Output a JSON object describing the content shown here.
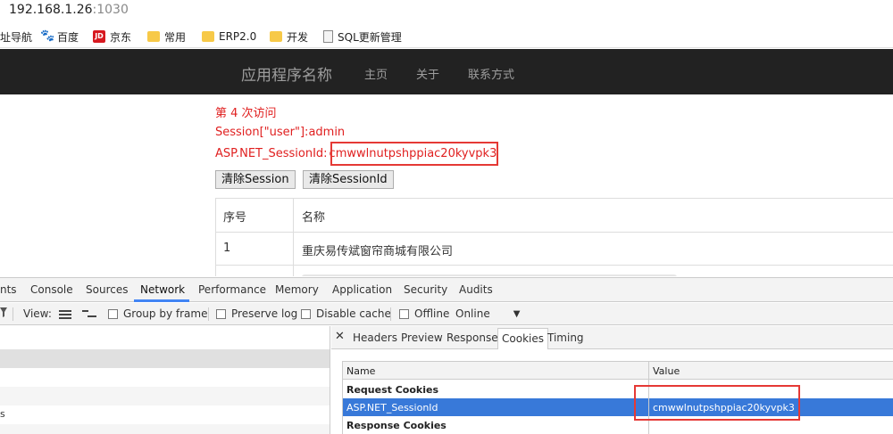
{
  "address_bar": {
    "host": "192.168.1.26",
    "port": ":1030"
  },
  "bookmarks": [
    {
      "label": "址导航",
      "icon": "none"
    },
    {
      "label": "百度",
      "icon": "paw-icon"
    },
    {
      "label": "京东",
      "icon": "jd-icon",
      "icon_text": "JD"
    },
    {
      "label": "常用",
      "icon": "folder-icon"
    },
    {
      "label": "ERP2.0",
      "icon": "folder-icon"
    },
    {
      "label": "开发",
      "icon": "folder-icon"
    },
    {
      "label": "SQL更新管理",
      "icon": "doc-icon"
    }
  ],
  "navbar": {
    "brand": "应用程序名称",
    "links": [
      "主页",
      "关于",
      "联系方式"
    ]
  },
  "page": {
    "visit_text": "第 4 次访问",
    "session_user": "Session[\"user\"]:admin",
    "session_id_label": "ASP.NET_SessionId:",
    "session_id_value": "cmwwlnutpshppiac20kyvpk3",
    "buttons": {
      "clear_session": "清除Session",
      "clear_session_id": "清除SessionId"
    },
    "table": {
      "headers": [
        "序号",
        "名称"
      ],
      "rows": [
        [
          "1",
          "重庆易传斌窗帘商城有限公司"
        ]
      ]
    }
  },
  "devtools": {
    "tabs": [
      "nts",
      "Console",
      "Sources",
      "Network",
      "Performance",
      "Memory",
      "Application",
      "Security",
      "Audits"
    ],
    "active_tab": "Network",
    "toolbar": {
      "view_label": "View:",
      "group_by_frame": "Group by frame",
      "preserve_log": "Preserve log",
      "disable_cache": "Disable cache",
      "offline": "Offline",
      "throttle": "Online"
    },
    "left_rows": [
      "",
      "",
      "",
      "s",
      ""
    ],
    "detail_tabs": [
      "Headers",
      "Preview",
      "Response",
      "Cookies",
      "Timing"
    ],
    "active_detail_tab": "Cookies",
    "cookie_table": {
      "col_name": "Name",
      "col_value": "Value",
      "request_group": "Request Cookies",
      "cookie_name": "ASP.NET_SessionId",
      "cookie_value": "cmwwlnutpshppiac20kyvpk3",
      "response_group": "Response Cookies"
    },
    "colors": {
      "selected_row": "#3879d9",
      "active_underline": "#4285f4",
      "highlight_box": "#e53935"
    }
  }
}
